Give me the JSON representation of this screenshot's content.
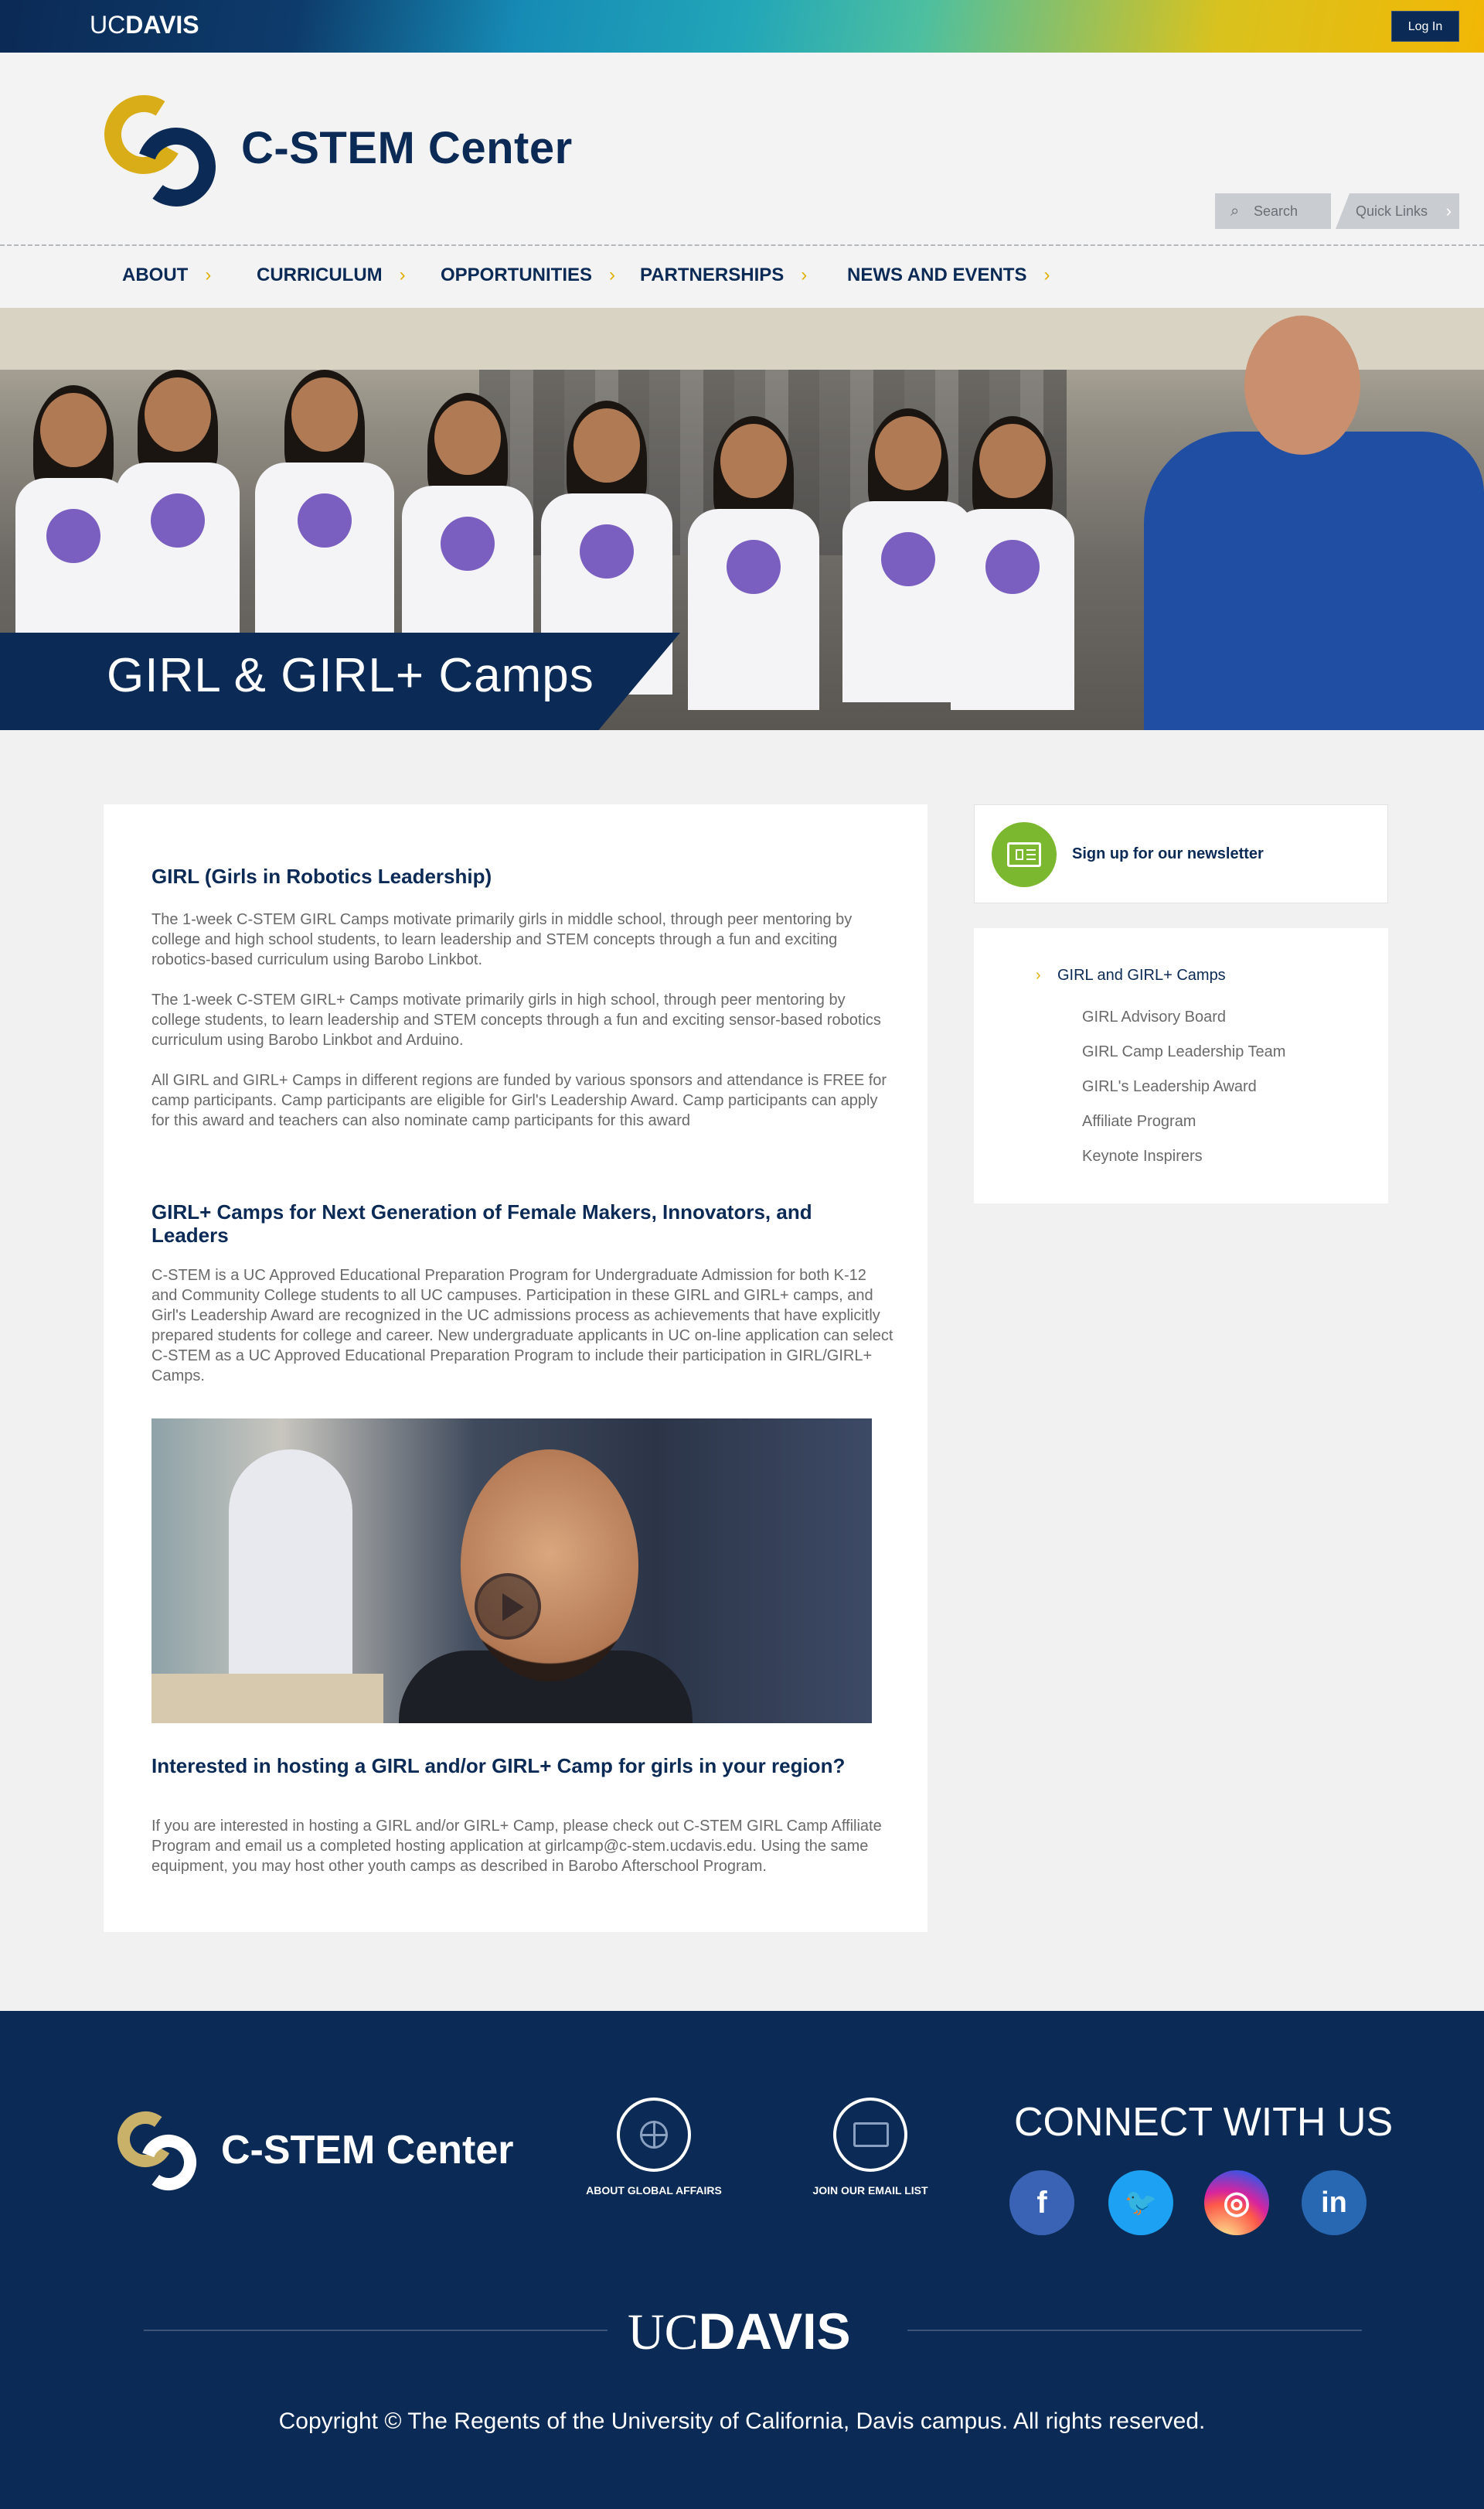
{
  "topbar": {
    "brand_light": "UC",
    "brand_bold": "DAVIS",
    "login_label": "Log In"
  },
  "header": {
    "site_name": "C-STEM Center",
    "search_label": "Search",
    "quick_links_label": "Quick Links"
  },
  "nav": {
    "items": [
      {
        "label": "ABOUT"
      },
      {
        "label": "CURRICULUM"
      },
      {
        "label": "OPPORTUNITIES"
      },
      {
        "label": "PARTNERSHIPS"
      },
      {
        "label": "NEWS AND EVENTS"
      }
    ]
  },
  "hero": {
    "title": "GIRL & GIRL+ Camps"
  },
  "main": {
    "h1": "GIRL (Girls in Robotics Leadership)",
    "p1": "The 1-week C-STEM GIRL Camps motivate primarily girls in middle school, through peer mentoring by college and high school students, to learn leadership and STEM concepts through a fun and exciting robotics-based curriculum using Barobo Linkbot.",
    "p2": "The 1-week C-STEM GIRL+ Camps motivate primarily girls in high school, through peer mentoring by college students, to learn leadership and STEM concepts through a fun and exciting sensor-based robotics curriculum using Barobo Linkbot and Arduino.",
    "p3": "All GIRL and GIRL+ Camps  in different regions are funded by various sponsors and attendance is FREE for camp participants. Camp participants are eligible for Girl's Leadership Award.  Camp participants can apply for this award and  teachers can also nominate camp participants for this award",
    "h2": "GIRL+ Camps for Next Generation of Female Makers, Innovators, and Leaders",
    "p4": "C-STEM is a UC Approved Educational Preparation Program for Undergraduate Admission for both K-12 and Community College students to all UC campuses. Participation in these GIRL and GIRL+ camps, and Girl's Leadership Award  are recognized in the UC admissions process as achievements that have explicitly prepared students for college and career. New undergraduate applicants in UC on-line application can select C-STEM as a UC Approved Educational Preparation Program to include their participation in GIRL/GIRL+ Camps.",
    "h3": "Interested in hosting a GIRL and/or GIRL+ Camp for girls in your region?",
    "p5": "If you are interested in hosting a GIRL and/or GIRL+ Camp, please check out C-STEM GIRL Camp Affiliate Program and email us a completed hosting application at girlcamp@c-stem.ucdavis.edu. Using the same equipment, you may host other youth camps as described in Barobo Afterschool Program."
  },
  "sidebar": {
    "newsletter_label": "Sign up for our newsletter",
    "active_item": "GIRL and GIRL+ Camps",
    "items": [
      {
        "label": "GIRL Advisory Board"
      },
      {
        "label": "GIRL Camp Leadership Team"
      },
      {
        "label": "GIRL's Leadership Award"
      },
      {
        "label": "Affiliate Program"
      },
      {
        "label": "Keynote Inspirers"
      }
    ]
  },
  "footer": {
    "site_name": "C-STEM Center",
    "global_affairs_label": "ABOUT GLOBAL AFFAIRS",
    "email_list_label": "JOIN OUR EMAIL LIST",
    "connect_label": "CONNECT WITH US",
    "social": [
      {
        "icon": "facebook-icon",
        "glyph": "f",
        "color": "#3b63b5"
      },
      {
        "icon": "twitter-icon",
        "glyph": "🐦",
        "color": "#1da1f2"
      },
      {
        "icon": "instagram-icon",
        "glyph": "◎",
        "color": "#c13584"
      },
      {
        "icon": "linkedin-icon",
        "glyph": "in",
        "color": "#2867b2"
      }
    ],
    "brand_light": "UC",
    "brand_bold": "DAVIS",
    "copyright": "Copyright © The Regents of the University of California, Davis campus. All rights reserved."
  },
  "colors": {
    "navy": "#0b2a55",
    "gold": "#e0b000",
    "green": "#7cb82f"
  }
}
